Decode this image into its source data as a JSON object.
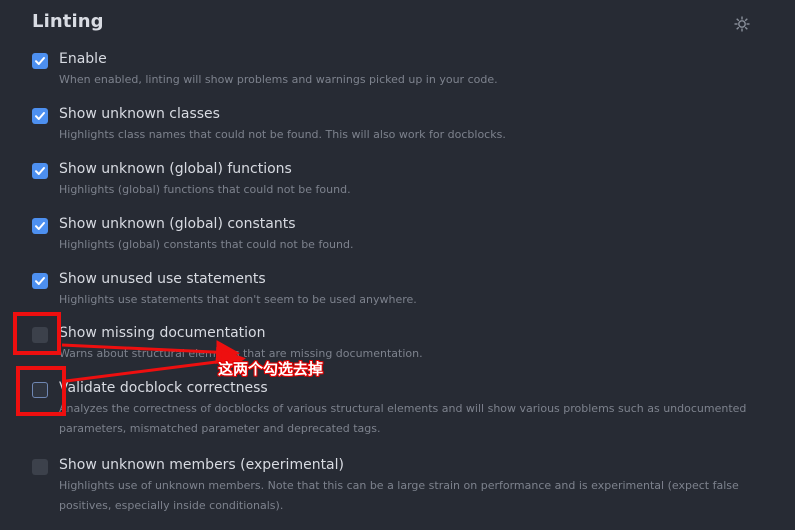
{
  "section": {
    "title": "Linting",
    "settings_icon": "gear-icon"
  },
  "options": [
    {
      "label": "Enable",
      "description": "When enabled, linting will show problems and warnings picked up in your code.",
      "checked": true
    },
    {
      "label": "Show unknown classes",
      "description": "Highlights class names that could not be found. This will also work for docblocks.",
      "checked": true
    },
    {
      "label": "Show unknown (global) functions",
      "description": "Highlights (global) functions that could not be found.",
      "checked": true
    },
    {
      "label": "Show unknown (global) constants",
      "description": "Highlights (global) constants that could not be found.",
      "checked": true
    },
    {
      "label": "Show unused use statements",
      "description": "Highlights use statements that don't seem to be used anywhere.",
      "checked": true
    },
    {
      "label": "Show missing documentation",
      "description": "Warns about structural elements that are missing documentation.",
      "checked": false
    },
    {
      "label": "Validate docblock correctness",
      "description": "Analyzes the correctness of docblocks of various structural elements and will show various problems such as undocumented parameters, mismatched parameter and deprecated tags.",
      "checked": false
    },
    {
      "label": "Show unknown members (experimental)",
      "description": "Highlights use of unknown members. Note that this can be a large strain on performance and is experimental (expect false positives, especially inside conditionals).",
      "checked": false
    }
  ],
  "annotation": {
    "text": "这两个勾选去掉",
    "color": "#ee0f0f"
  },
  "colors": {
    "background": "#272b34",
    "checkbox_checked": "#4d90f0",
    "checkbox_unchecked": "#3c414b",
    "label": "#d8dbe2",
    "description": "#7d828d"
  }
}
